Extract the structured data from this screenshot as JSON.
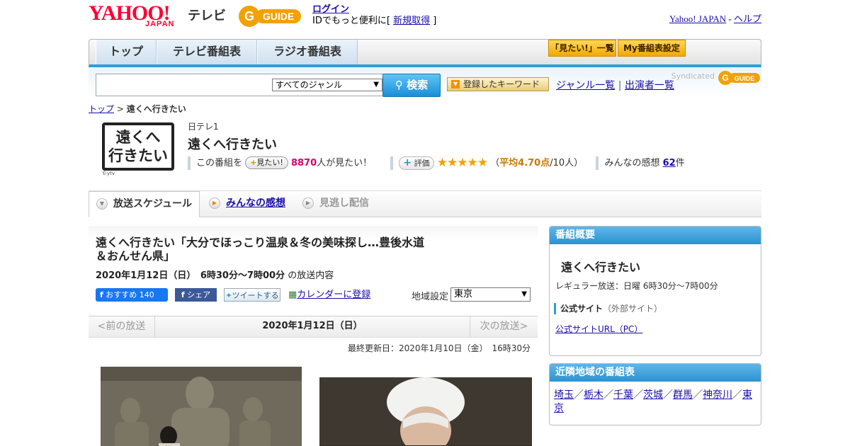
{
  "header": {
    "logo_yahoo": "YAHOO!",
    "logo_japan": "JAPAN",
    "logo_tv": "テレビ",
    "logo_gguide": "GUIDE",
    "login": "ログイン",
    "login_note": "IDでもっと便利に[",
    "signup": "新規取得",
    "signup_close": "]",
    "yahoo_japan_link": "Yahoo! JAPAN",
    "separator": " - ",
    "help_link": "ヘルプ"
  },
  "nav": {
    "tabs": [
      {
        "label": "トップ"
      },
      {
        "label": "テレビ番組表"
      },
      {
        "label": "ラジオ番組表"
      }
    ],
    "watchlist_button": "「見たい!」一覧",
    "my_schedule_button": "My番組表設定"
  },
  "search": {
    "placeholder": "",
    "genre_selected": "すべてのジャンル",
    "search_button": "検索",
    "keyword_button": "登録したキーワード",
    "genre_list_link": "ジャンル一覧",
    "divider": " | ",
    "cast_list_link": "出演者一覧",
    "syndicated": "Syndicated"
  },
  "breadcrumb": {
    "top": "トップ",
    "sep": " > ",
    "current": "遠くへ行きたい"
  },
  "program": {
    "thumb_line1": "遠くへ",
    "thumb_line2": "行きたい",
    "thumb_copyright": "©ytv",
    "station": "日テレ1",
    "title": "遠くへ行きたい",
    "mitai_prefix": "この番組を",
    "mitai_button": "見たい!",
    "mitai_count": "8870",
    "mitai_suffix": "人が見たい！",
    "rate_button": "評価",
    "stars": "★★★★★",
    "avg_open": "（",
    "avg_label": "平均4.70点",
    "avg_count": "/10人）",
    "reviews_label": "みんなの感想",
    "reviews_count": "62",
    "reviews_unit": "件"
  },
  "subtabs": [
    {
      "label": "放送スケジュール"
    },
    {
      "label": "みんなの感想"
    },
    {
      "label": "見逃し配信"
    }
  ],
  "episode": {
    "title": "遠くへ行きたい「大分でほっこり温泉＆冬の美味探し…豊後水道＆おんせん県」",
    "date": "2020年1月12日（日）　6時30分～7時00分",
    "date_suffix": "の放送内容",
    "fb_recommend": "おすすめ 140",
    "fb_share": "シェア",
    "tweet": "ツイートする",
    "calendar": "カレンダーに登録",
    "region_label": "地域設定",
    "region_selected": "東京"
  },
  "pager": {
    "prev": "<前の放送",
    "current": "2020年1月12日（日）",
    "next": "次の放送>"
  },
  "last_updated": "最終更新日：2020年1月10日（金）　16時30分",
  "overview": {
    "header": "番組概要",
    "title": "遠くへ行きたい",
    "regular": "レギュラー放送：日曜 6時30分～7時00分",
    "official_site": "公式サイト",
    "official_site_note": "（外部サイト）",
    "official_url": "公式サイトURL（PC）"
  },
  "nearby": {
    "header": "近隣地域の番組表",
    "regions": [
      "埼玉",
      "栃木",
      "千葉",
      "茨城",
      "群馬",
      "神奈川",
      "東京"
    ],
    "sep": "／"
  },
  "colors": {
    "accent_blue": "#2d9fd8",
    "yahoo_red": "#ff0033",
    "gguide_orange": "#f3a100",
    "link": "#1a0dab"
  }
}
